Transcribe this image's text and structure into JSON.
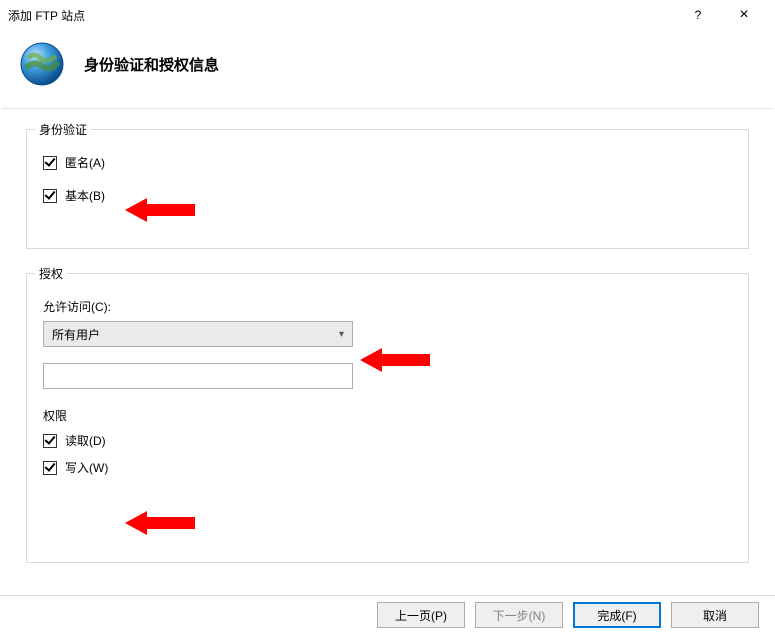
{
  "window": {
    "title": "添加 FTP 站点",
    "help": "?",
    "close": "×"
  },
  "header": {
    "heading": "身份验证和授权信息"
  },
  "auth": {
    "legend": "身份验证",
    "anonymous": "匿名(A)",
    "basic": "基本(B)"
  },
  "authz": {
    "legend": "授权",
    "allow_access_label": "允许访问(C):",
    "allow_access_value": "所有用户",
    "extra_value": ""
  },
  "perm": {
    "label": "权限",
    "read": "读取(D)",
    "write": "写入(W)"
  },
  "footer": {
    "prev": "上一页(P)",
    "next": "下一步(N)",
    "finish": "完成(F)",
    "cancel": "取消"
  }
}
